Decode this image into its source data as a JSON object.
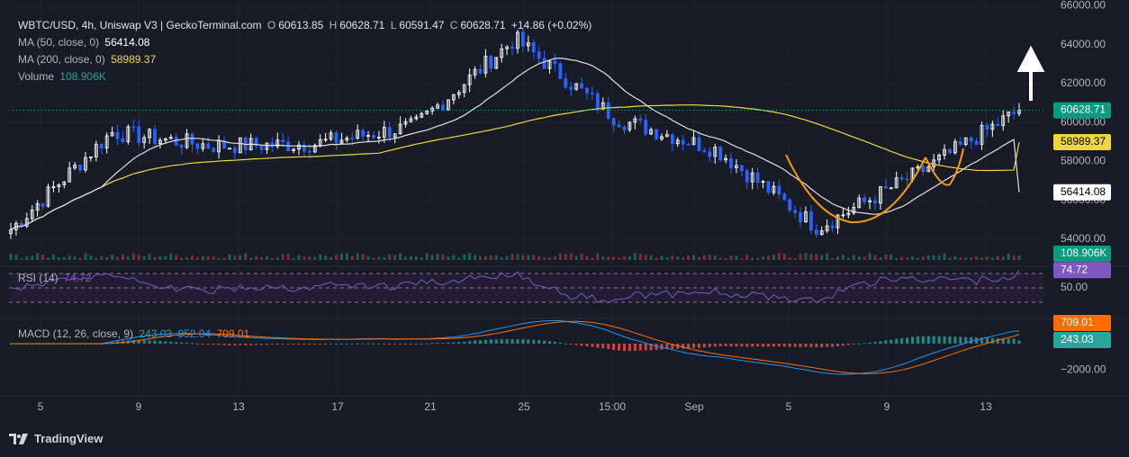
{
  "header": {
    "symbol": "WBTC/USD, 4h, Uniswap V3 | GeckoTerminal.com",
    "o_label": "O",
    "o_value": "60613.85",
    "h_label": "H",
    "h_value": "60628.71",
    "l_label": "L",
    "l_value": "60591.47",
    "c_label": "C",
    "c_value": "60628.71",
    "change": "+14.86 (+0.02%)"
  },
  "legends": {
    "ma50_label": "MA (50, close, 0)",
    "ma50_value": "56414.08",
    "ma200_label": "MA (200, close, 0)",
    "ma200_value": "58989.37",
    "volume_label": "Volume",
    "volume_value": "108.906K",
    "rsi_label": "RSI (14)",
    "rsi_value": "74.72",
    "macd_label": "MACD (12, 26, close, 9)",
    "macd_v1": "243.03",
    "macd_v2": "952.04",
    "macd_v3": "709.01"
  },
  "footer": {
    "brand": "TradingView"
  },
  "colors": {
    "background": "#171b26",
    "up": "#ffffff",
    "down": "#2962ff",
    "ma50": "#e0e0e0",
    "ma200": "#f0d640",
    "pattern": "#ff9800",
    "rsi": "#7e57c2",
    "macd": "#2196f3",
    "signal": "#ff6d00",
    "hist_up": "#26a69a",
    "hist_down": "#ef5350",
    "current_price": "#089981"
  },
  "chart_data": {
    "type": "candlestick",
    "title": "WBTC/USD, 4h, Uniswap V3 | GeckoTerminal.com",
    "x_ticks": [
      "5",
      "9",
      "13",
      "17",
      "21",
      "25",
      "15:00",
      "Sep",
      "5",
      "9",
      "13"
    ],
    "price_axis_ticks": [
      54000,
      56000,
      58000,
      60000,
      62000,
      64000,
      66000
    ],
    "price_range": [
      52800,
      66200
    ],
    "last_price": 60628.71,
    "price_series_approx": {
      "x": [
        "5",
        "9",
        "13",
        "17",
        "21",
        "25",
        "15:00",
        "Sep",
        "5",
        "9",
        "13"
      ],
      "close": [
        54500,
        59500,
        58800,
        58900,
        59800,
        64300,
        60200,
        58600,
        54600,
        57400,
        60628.71
      ]
    },
    "ma50_last": 56414.08,
    "ma200_last": 58989.37,
    "volume_last": "108.906K",
    "rsi": {
      "period": 14,
      "last": 74.72,
      "ticks": [
        50
      ]
    },
    "macd": {
      "fast": 12,
      "slow": 26,
      "signal": 9,
      "values": [
        243.03,
        952.04,
        709.01
      ],
      "ticks": [
        -2000
      ]
    },
    "annotation": "cup and handle pattern with upward arrow"
  }
}
